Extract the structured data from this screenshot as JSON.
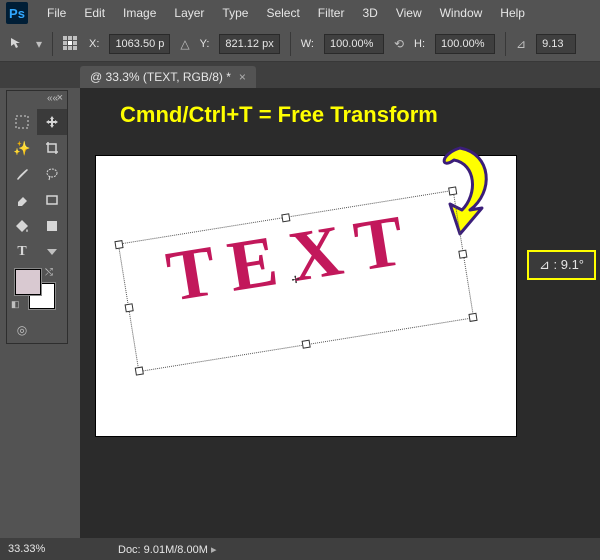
{
  "app": {
    "logo": "Ps"
  },
  "menu": {
    "items": [
      "File",
      "Edit",
      "Image",
      "Layer",
      "Type",
      "Select",
      "Filter",
      "3D",
      "View",
      "Window",
      "Help"
    ]
  },
  "options": {
    "x_label": "X:",
    "x_value": "1063.50 p",
    "y_label": "Y:",
    "y_value": "821.12 px",
    "w_label": "W:",
    "w_value": "100.00%",
    "h_label": "H:",
    "h_value": "100.00%",
    "angle_value": "9.13"
  },
  "tab": {
    "title": "@ 33.3% (TEXT, RGB/8) *"
  },
  "tutorial": {
    "label": "Cmnd/Ctrl+T = Free Transform"
  },
  "canvas": {
    "sample_text": "TEXT",
    "angle_tooltip": "⊿ : 9.1°"
  },
  "swatches": {
    "fg": "#d9c9d1",
    "bg": "#ffffff"
  },
  "status": {
    "zoom": "33.33%",
    "doc": "Doc: 9.01M/8.00M"
  }
}
